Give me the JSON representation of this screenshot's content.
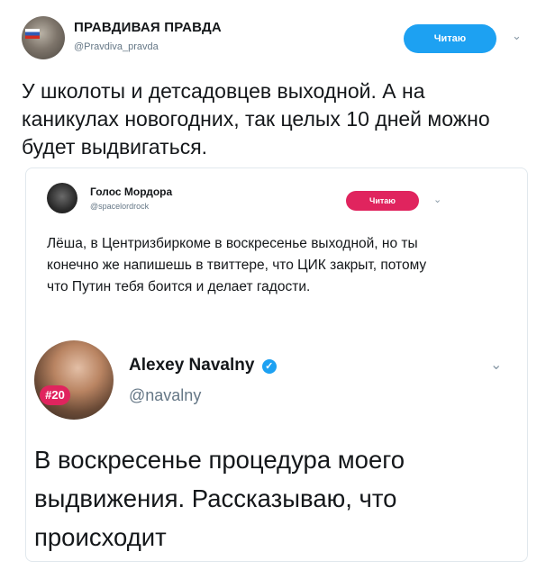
{
  "outer_tweet": {
    "author_name": "ПРАВДИВАЯ ПРАВДА",
    "handle": "@Pravdiva_pravda",
    "follow_label": "Читаю",
    "text": "У школоты и детсадовцев выходной. А на каникулах новогодних, так целых 10 дней можно будет выдвигаться."
  },
  "quoted_tweet": {
    "author_name": "Голос Мордора",
    "handle": "@spacelordrock",
    "follow_label": "Читаю",
    "text": "Лёша, в Центризбиркоме в воскресенье выходной, но ты конечно же напишешь в твиттере, что ЦИК закрыт, потому что Путин тебя боится и делает гадости."
  },
  "nested_tweet": {
    "author_name": "Alexey Navalny",
    "handle": "@navalny",
    "avatar_badge": "#20",
    "text": "В воскресенье процедура моего выдвижения. Рассказываю, что происходит"
  },
  "colors": {
    "follow_outer": "#1da1f2",
    "follow_quoted": "#e0245e",
    "verified": "#1da1f2"
  }
}
